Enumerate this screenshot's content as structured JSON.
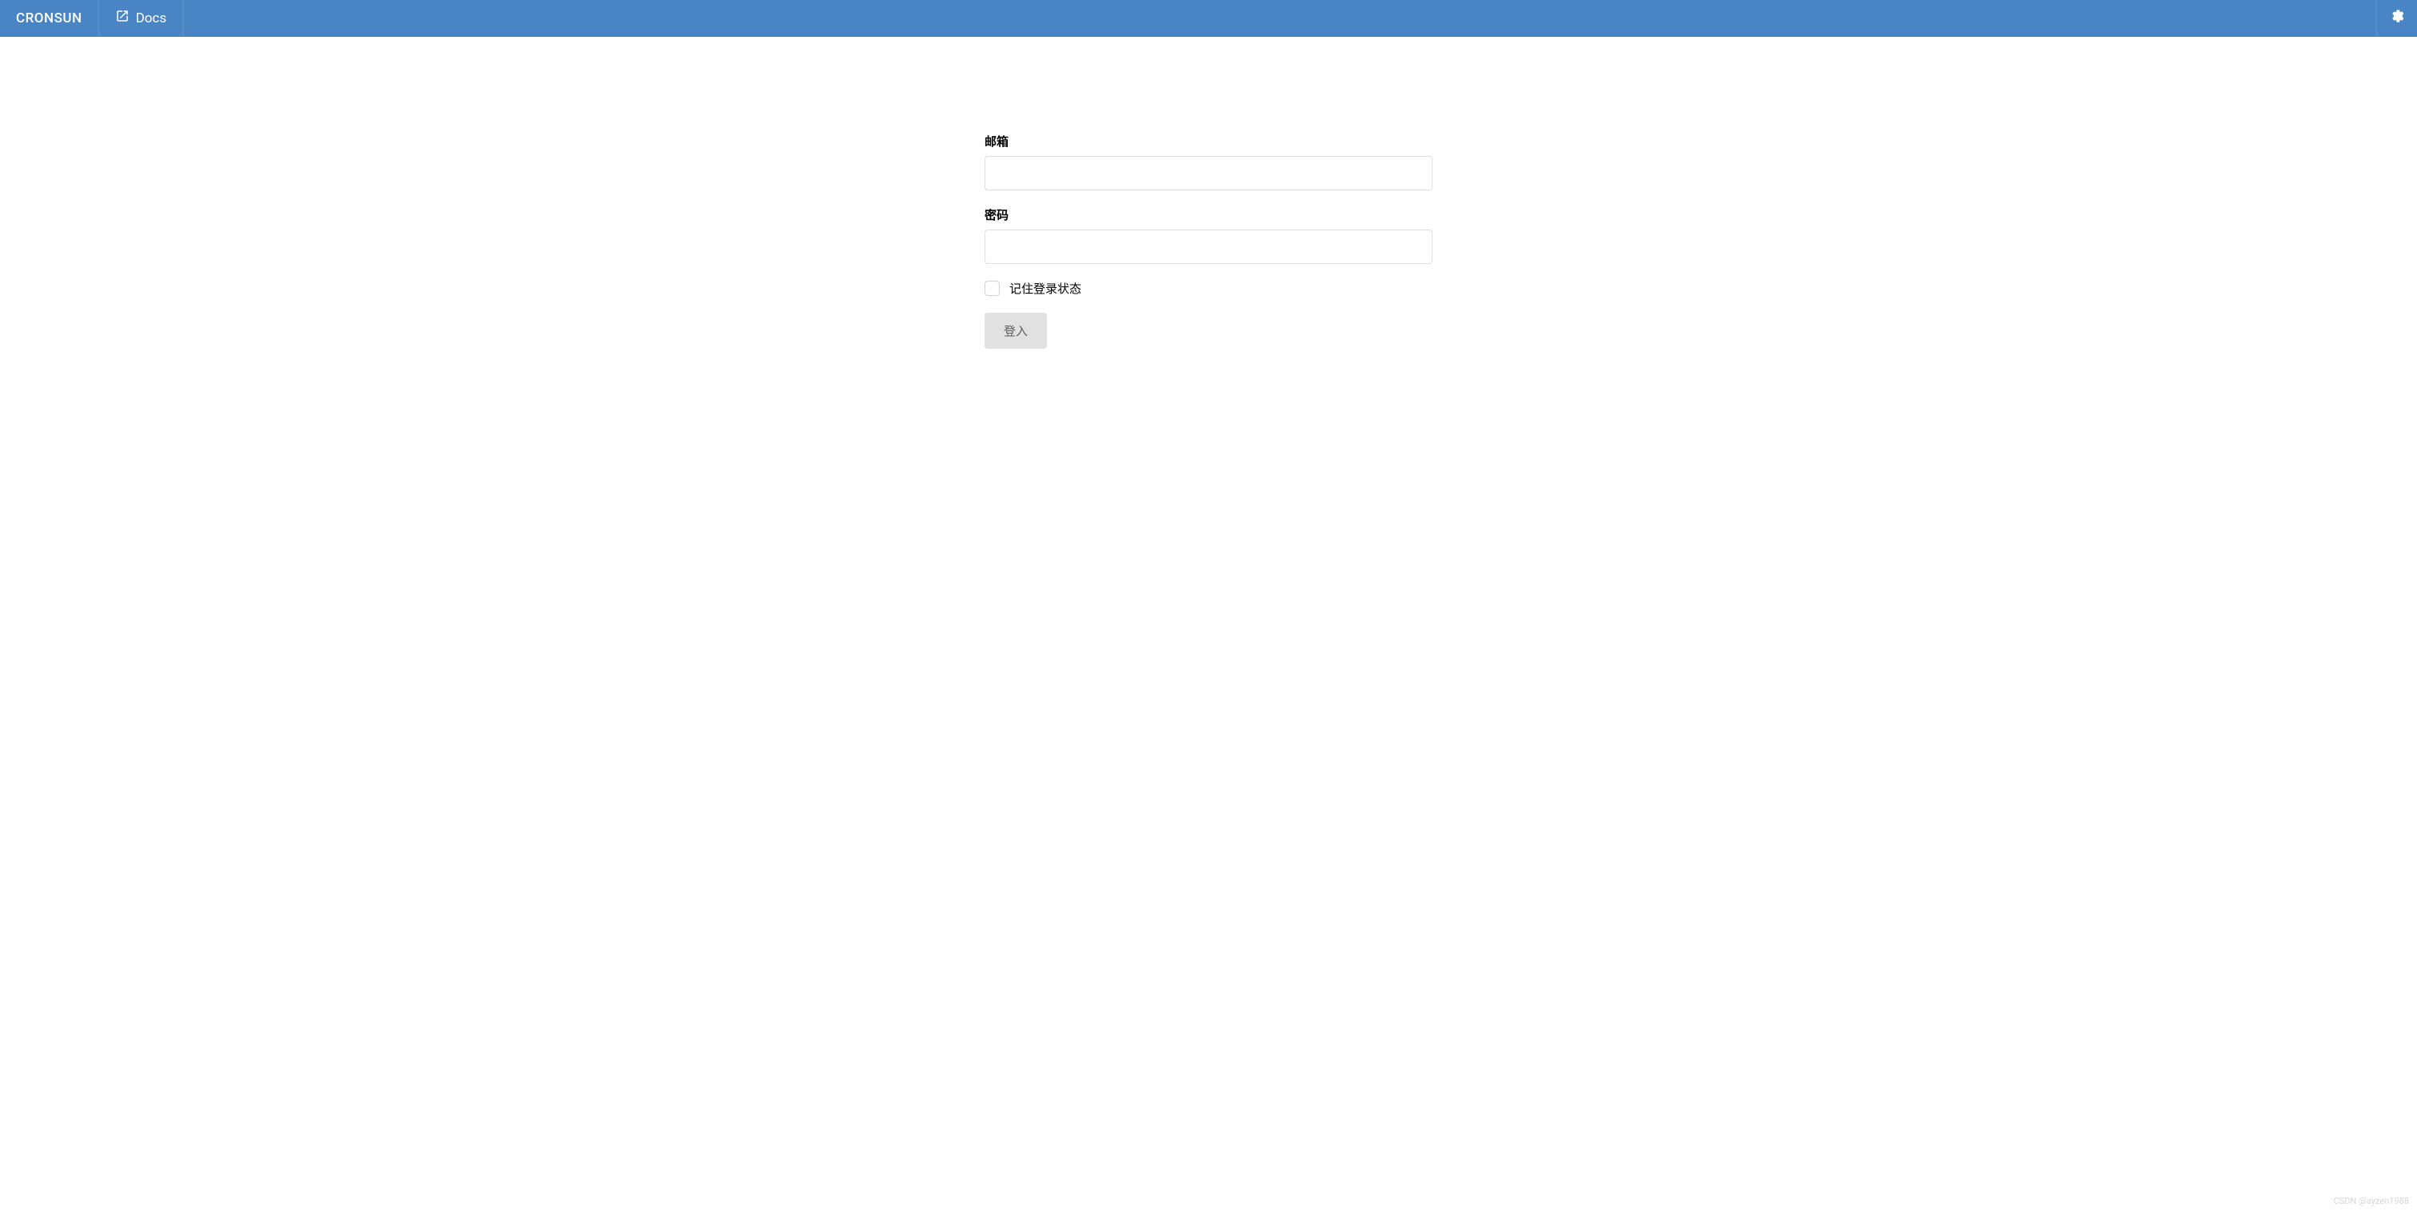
{
  "navbar": {
    "brand": "CRONSUN",
    "docs": "Docs"
  },
  "login": {
    "email_label": "邮箱",
    "password_label": "密码",
    "remember_label": "记住登录状态",
    "submit_label": "登入",
    "email_value": "",
    "password_value": ""
  },
  "watermark": "CSDN @ayzen1988"
}
